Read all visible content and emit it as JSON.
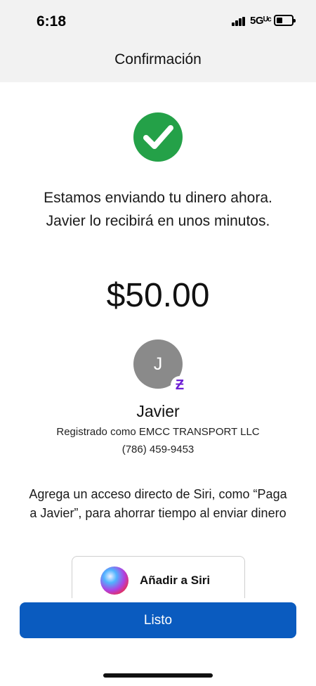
{
  "status_bar": {
    "time": "6:18",
    "network": "5Gᵁᶜ",
    "signal_icon": "signal-bars-icon",
    "battery_icon": "battery-icon"
  },
  "header": {
    "title": "Confirmación"
  },
  "confirmation": {
    "icon": "checkmark-circle-icon",
    "color": "#24a148",
    "message": "Estamos enviando tu dinero ahora. Javier lo recibirá en unos minutos.",
    "amount": "$50.00"
  },
  "recipient": {
    "initial": "J",
    "badge": "Ƶ",
    "badge_color": "#6d1ed4",
    "name": "Javier",
    "registered": "Registrado como EMCC TRANSPORT LLC",
    "phone": "(786) 459-9453"
  },
  "siri": {
    "prompt": "Agrega un acceso directo de Siri, como “Paga a Javier”, para ahorrar tiempo al enviar dinero",
    "button_label": "Añadir a Siri",
    "icon": "siri-icon"
  },
  "footer": {
    "done_label": "Listo",
    "accent": "#0a5bbf"
  }
}
